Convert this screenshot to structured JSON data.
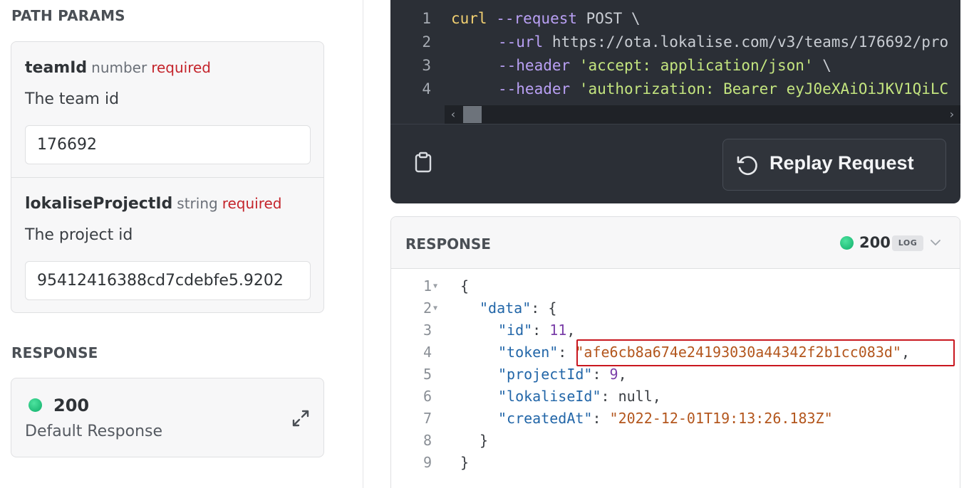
{
  "left": {
    "path_params_title": "PATH PARAMS",
    "params": [
      {
        "name": "teamId",
        "type": "number",
        "required": "required",
        "description": "The team id",
        "value": "176692"
      },
      {
        "name": "lokaliseProjectId",
        "type": "string",
        "required": "required",
        "description": "The project id",
        "value": "95412416388cd7cdebfe5.9202"
      }
    ],
    "response_title": "RESPONSE",
    "response": {
      "code": "200",
      "description": "Default Response",
      "status_color": "#1fc07c"
    }
  },
  "request_code": {
    "lines": [
      {
        "num": "1",
        "kw": "curl",
        "flag": " --request",
        "text": " POST \\"
      },
      {
        "num": "2",
        "flag": "--url",
        "text": " https://ota.lokalise.com/v3/teams/176692/pro"
      },
      {
        "num": "3",
        "flag": "--header",
        "text": " ",
        "str": "'accept: application/json'",
        "tail": " \\"
      },
      {
        "num": "4",
        "flag": "--header",
        "text": " ",
        "str": "'authorization: Bearer eyJ0eXAiOiJKV1QiLC"
      }
    ],
    "replay_label": "Replay Request"
  },
  "response_panel": {
    "title": "RESPONSE",
    "status_code": "200",
    "log_label": "LOG",
    "json": {
      "line1": "{",
      "data_key": "\"data\"",
      "id_key": "\"id\"",
      "id_value": "11",
      "token_key": "\"token\"",
      "token_value": "\"afe6cb8a674e24193030a44342f2b1cc083d\"",
      "project_key": "\"projectId\"",
      "project_value": "9",
      "lokalise_key": "\"lokaliseId\"",
      "lokalise_value": "null",
      "created_key": "\"createdAt\"",
      "created_value": "\"2022-12-01T19:13:26.183Z\"",
      "close_inner": "}",
      "close_outer": "}"
    },
    "line_numbers": [
      "1",
      "2",
      "3",
      "4",
      "5",
      "6",
      "7",
      "8",
      "9"
    ],
    "highlight_color": "#c9171f"
  }
}
